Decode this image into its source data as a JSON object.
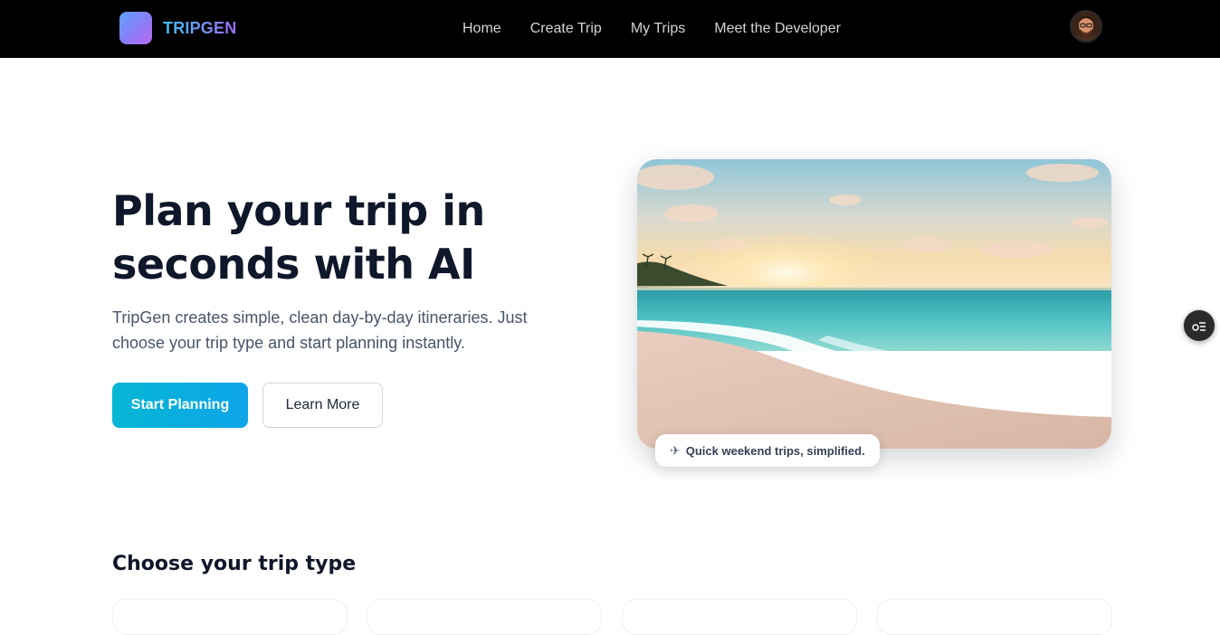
{
  "brand": {
    "name": "TRIPGEN"
  },
  "nav": {
    "links": [
      {
        "label": "Home"
      },
      {
        "label": "Create Trip"
      },
      {
        "label": "My Trips"
      },
      {
        "label": "Meet the Developer"
      }
    ]
  },
  "hero": {
    "title": "Plan your trip in seconds with AI",
    "subtitle": "TripGen creates simple, clean day-by-day itineraries. Just choose your trip type and start planning instantly.",
    "primary_button": "Start Planning",
    "secondary_button": "Learn More",
    "image_caption": "Quick weekend trips, simplified.",
    "caption_icon": "airplane-icon"
  },
  "trip_types": {
    "heading": "Choose your trip type"
  },
  "colors": {
    "nav_bg": "#000000",
    "accent": "#0ea5e9",
    "heading": "#0f172a",
    "body_text": "#475569"
  }
}
